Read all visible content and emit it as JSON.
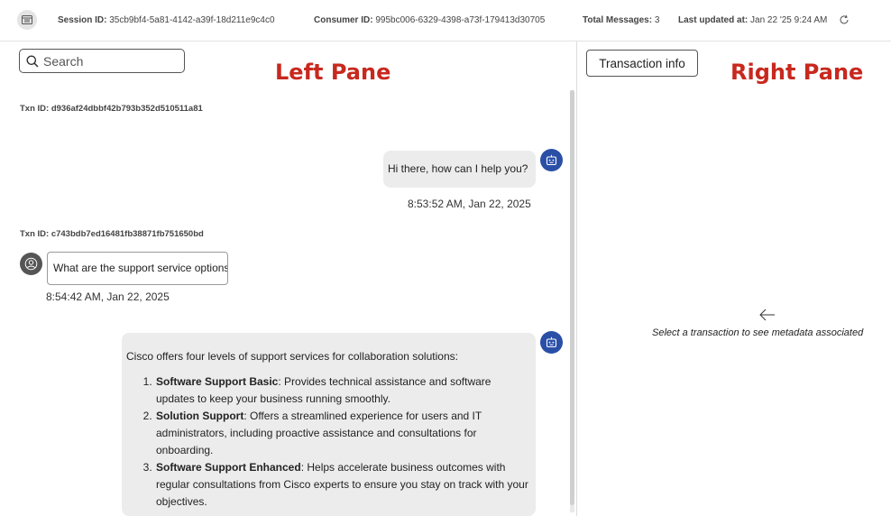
{
  "header": {
    "session_label": "Session ID:",
    "session_value": "35cb9bf4-5a81-4142-a39f-18d211e9c4c0",
    "consumer_label": "Consumer ID:",
    "consumer_value": "995bc006-6329-4398-a73f-179413d30705",
    "messages_label": "Total Messages:",
    "messages_value": "3",
    "updated_label": "Last updated at:",
    "updated_value": "Jan 22 '25 9:24 AM",
    "icons": [
      "app-icon",
      "refresh-icon"
    ]
  },
  "left_pane": {
    "tag": "Left Pane",
    "search": {
      "placeholder": "Search",
      "value": ""
    },
    "transactions": [
      {
        "txn_label": "Txn ID: d936af24dbbf42b793b352d510511a81",
        "messages": [
          {
            "role": "bot",
            "text": "Hi there, how can I help you?",
            "timestamp": "8:53:52 AM, Jan 22, 2025"
          }
        ]
      },
      {
        "txn_label": "Txn ID: c743bdb7ed16481fb38871fb751650bd",
        "messages": [
          {
            "role": "user",
            "text": "What are the support service options",
            "timestamp": "8:54:42 AM, Jan 22, 2025"
          },
          {
            "role": "bot",
            "intro": "Cisco offers four levels of support services for collaboration solutions:",
            "items": [
              {
                "title": "Software Support Basic",
                "body": ": Provides technical assistance and software updates to keep your business running smoothly."
              },
              {
                "title": "Solution Support",
                "body": ": Offers a streamlined experience for users and IT administrators, including proactive assistance and consultations for onboarding."
              },
              {
                "title": "Software Support Enhanced",
                "body": ": Helps accelerate business outcomes with regular consultations from Cisco experts to ensure you stay on track with your objectives."
              }
            ]
          }
        ]
      }
    ]
  },
  "right_pane": {
    "tag": "Right Pane",
    "txn_info_button": "Transaction info",
    "empty_message": "Select a transaction to see metadata associated"
  },
  "colors": {
    "annotation_red": "#c8281e",
    "bot_avatar": "#2a4fa6",
    "bot_bubble": "#ececec"
  }
}
